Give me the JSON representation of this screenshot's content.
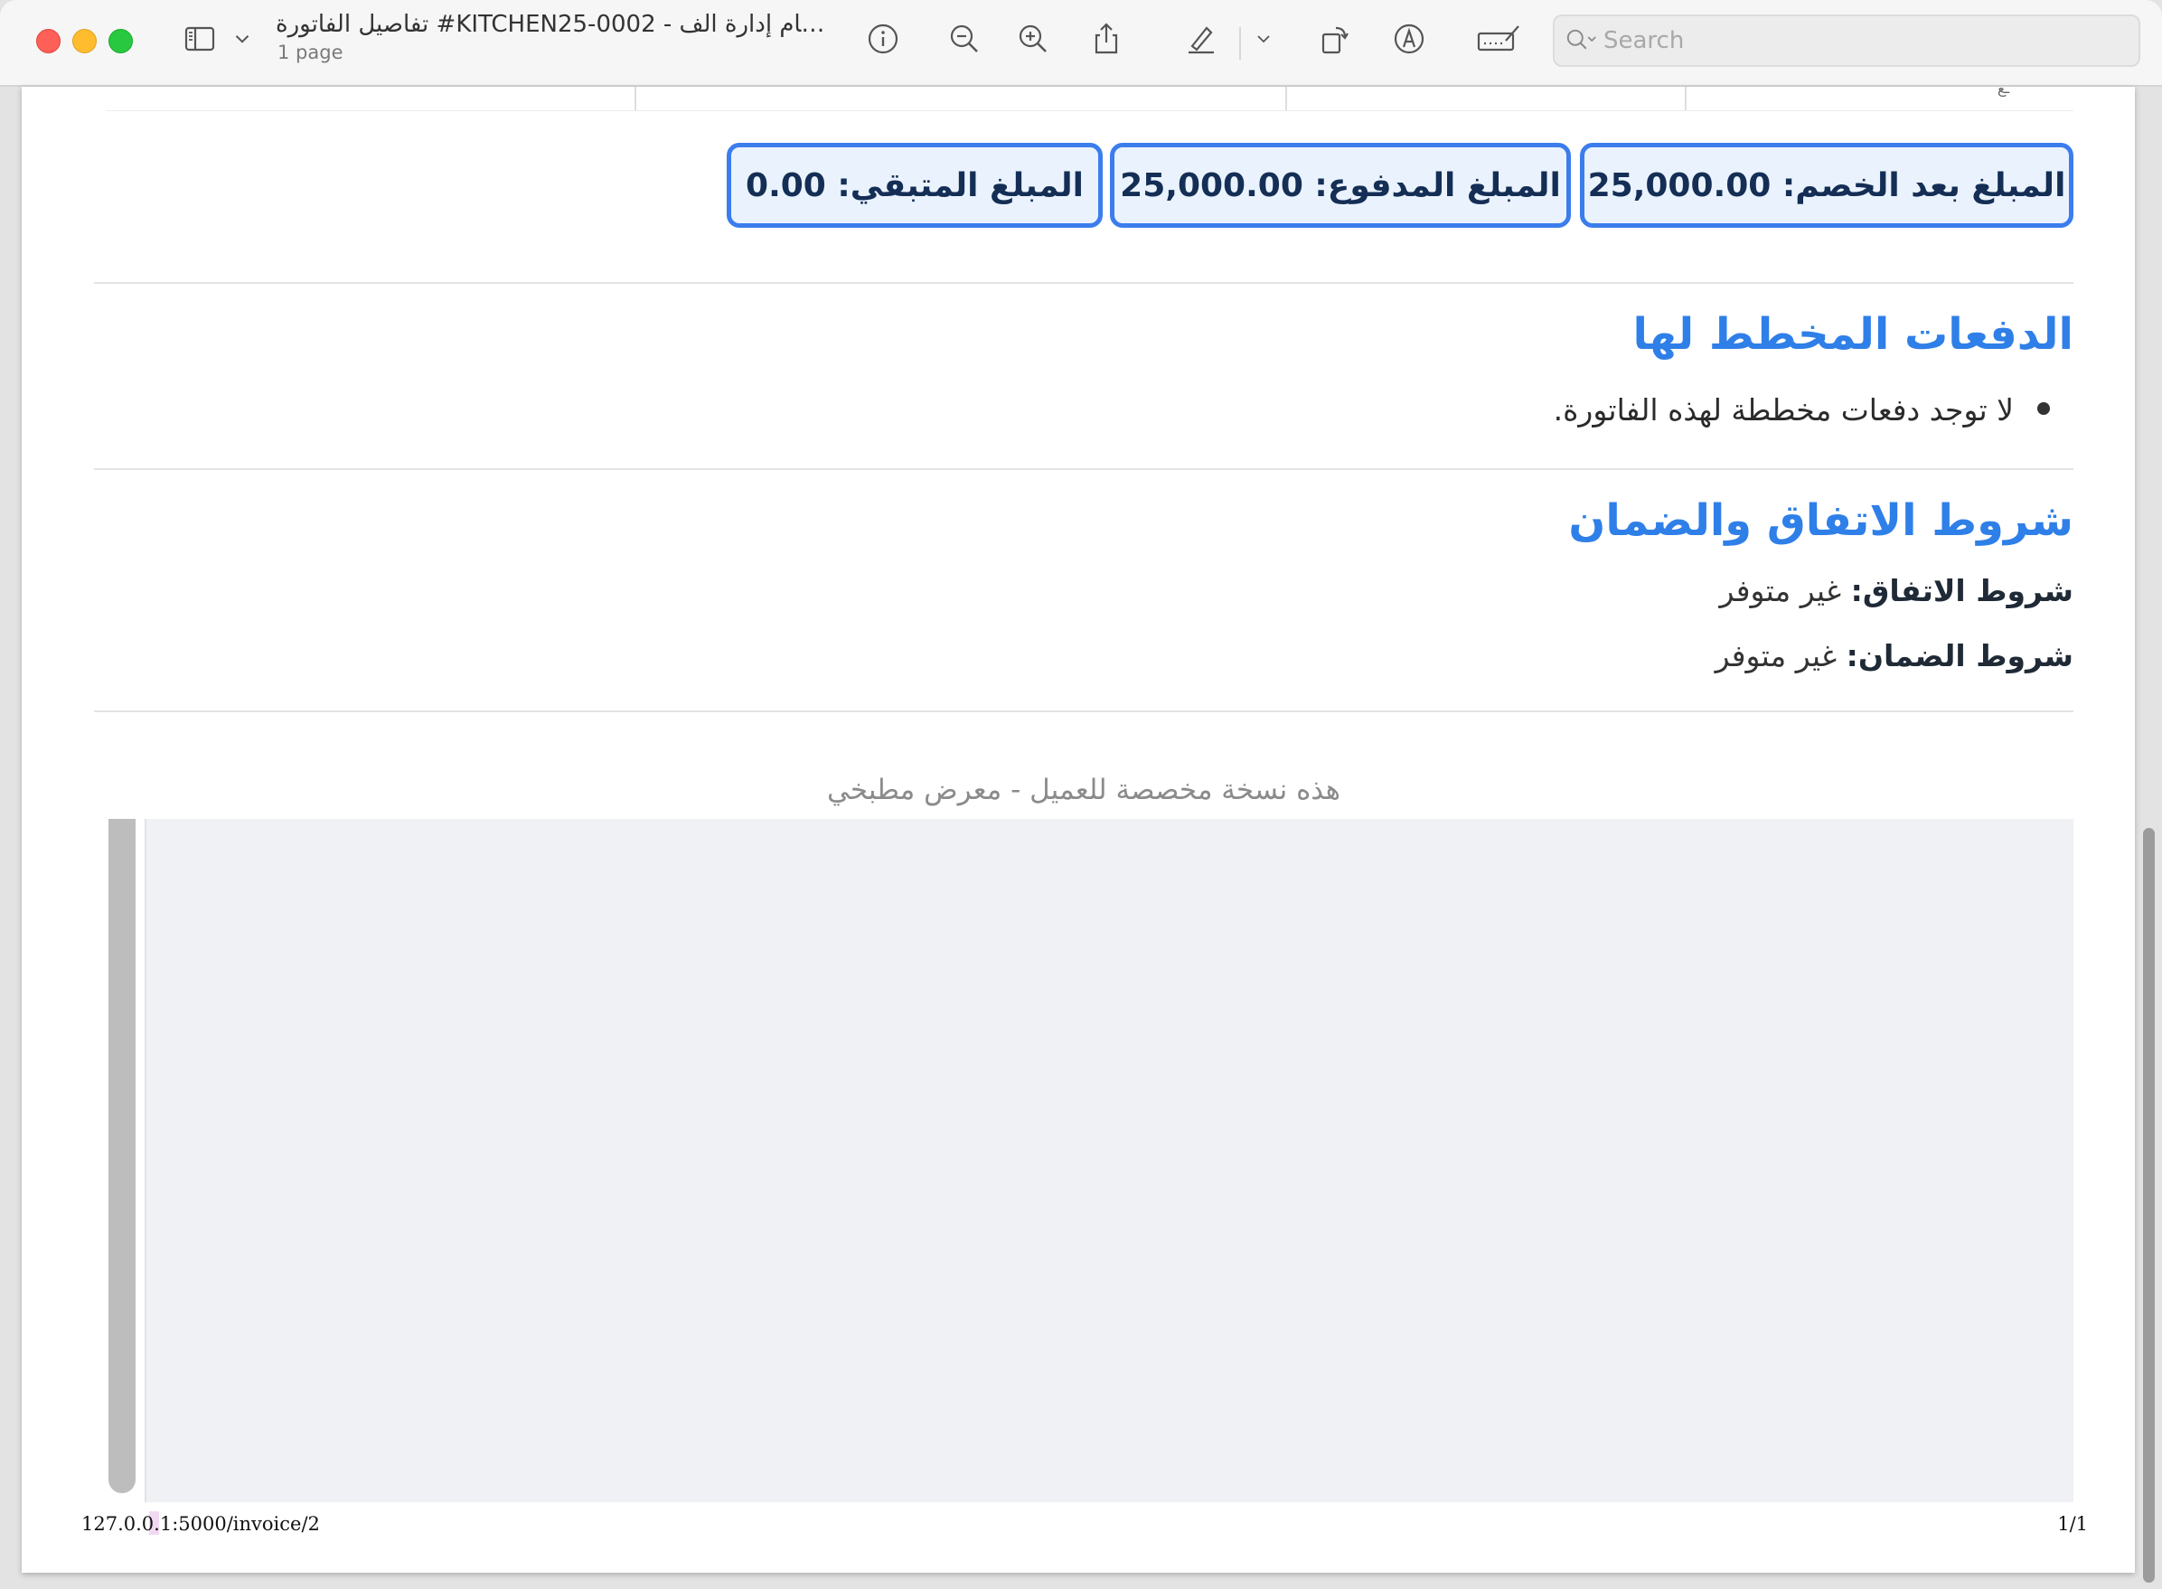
{
  "window": {
    "title": "تفاصيل الفاتورة #KITCHEN25-0002 - نظام إدارة الف...",
    "subtitle": "1 page"
  },
  "toolbar": {
    "search_placeholder": "Search",
    "icons": [
      "sidebar-icon",
      "chevron-down-icon",
      "info-icon",
      "zoom-out-icon",
      "zoom-in-icon",
      "share-icon",
      "pen-icon",
      "chevron-down-icon",
      "rotate-icon",
      "markup-icon",
      "signature-icon",
      "search-icon"
    ]
  },
  "invoice": {
    "amounts": {
      "after_discount": "المبلغ بعد الخصم: 25,000.00",
      "paid": "المبلغ المدفوع: 25,000.00",
      "remaining": "المبلغ المتبقي: 0.00"
    },
    "planned_payments": {
      "title": "الدفعات المخطط لها",
      "empty_message": "لا توجد دفعات مخططة لهذه الفاتورة."
    },
    "terms": {
      "title": "شروط الاتفاق والضمان",
      "agreement_label": "شروط الاتفاق:",
      "agreement_value": "غير متوفر",
      "warranty_label": "شروط الضمان:",
      "warranty_value": "غير متوفر"
    },
    "footer_note": "هذه نسخة مخصصة للعميل - معرض مطبخي"
  },
  "print": {
    "url": "127.0.0.1:5000/invoice/2",
    "page_counter": "1/1"
  },
  "colors": {
    "accent_blue": "#2f7fe8",
    "box_border": "#3b7ded",
    "box_fill": "#eaf3fd",
    "box_text": "#142e55"
  }
}
